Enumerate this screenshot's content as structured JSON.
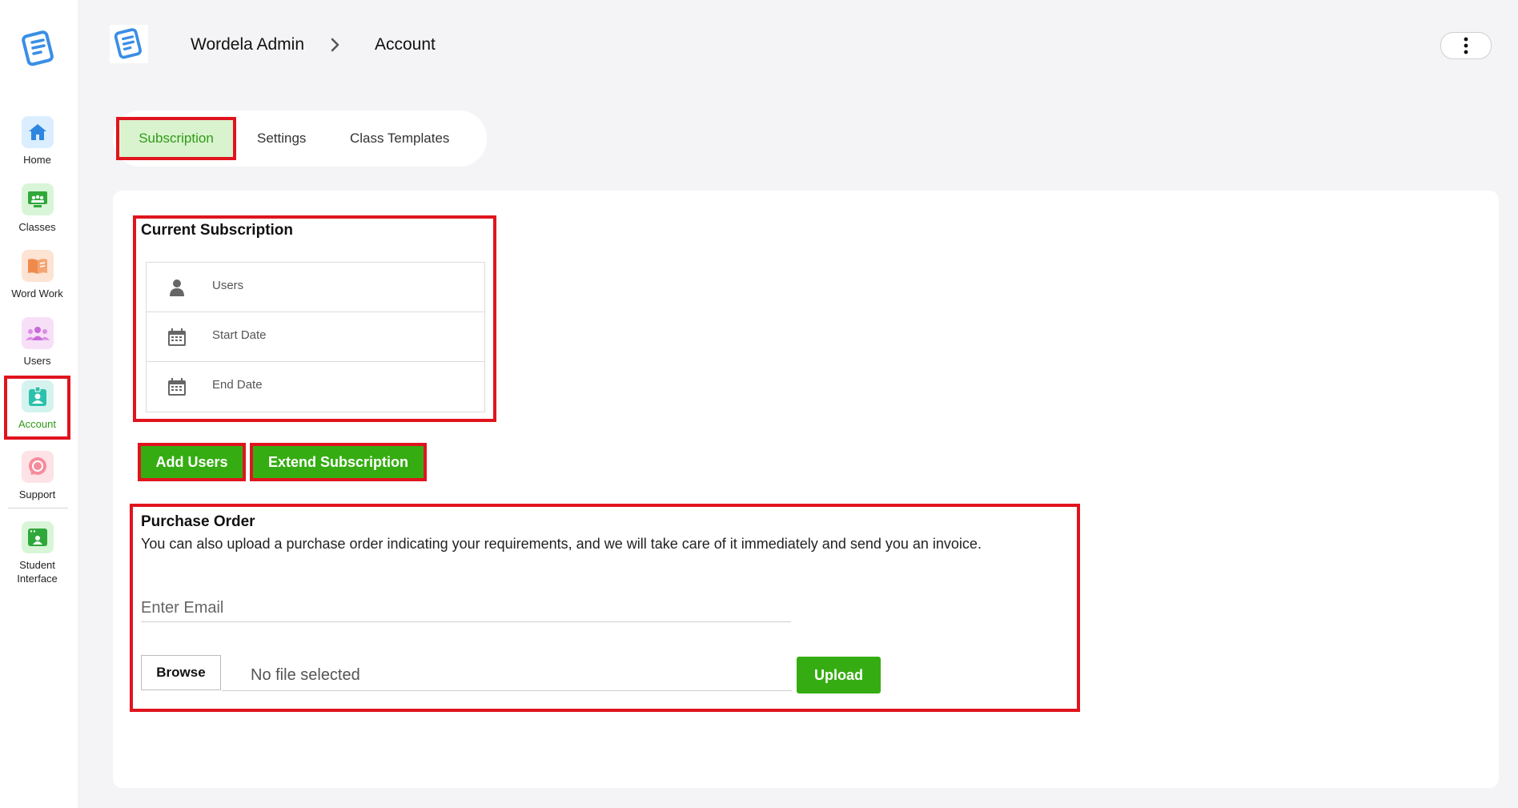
{
  "sidebar": {
    "items": [
      {
        "label": "Home",
        "icon": "home-icon"
      },
      {
        "label": "Classes",
        "icon": "classes-icon"
      },
      {
        "label": "Word Work",
        "icon": "book-icon"
      },
      {
        "label": "Users",
        "icon": "users-icon"
      },
      {
        "label": "Account",
        "icon": "account-icon"
      },
      {
        "label": "Support",
        "icon": "support-icon"
      },
      {
        "label": "Student\nInterface",
        "icon": "student-interface-icon"
      }
    ]
  },
  "header": {
    "breadcrumb_root": "Wordela Admin",
    "breadcrumb_current": "Account"
  },
  "tabs": [
    {
      "label": "Subscription"
    },
    {
      "label": "Settings"
    },
    {
      "label": "Class Templates"
    }
  ],
  "subscription": {
    "title": "Current Subscription",
    "rows": [
      {
        "label": "Users"
      },
      {
        "label": "Start Date"
      },
      {
        "label": "End Date"
      }
    ],
    "add_users_label": "Add Users",
    "extend_label": "Extend Subscription"
  },
  "purchase_order": {
    "title": "Purchase Order",
    "description": "You can also upload a purchase order indicating your requirements, and we will take care of it immediately and send you an invoice.",
    "email_placeholder": "Enter Email",
    "browse_label": "Browse",
    "file_status": "No file selected",
    "upload_label": "Upload"
  },
  "colors": {
    "accent": "#35ad12",
    "highlight": "#e0141e",
    "active_tab_bg": "#d9f3cf"
  }
}
